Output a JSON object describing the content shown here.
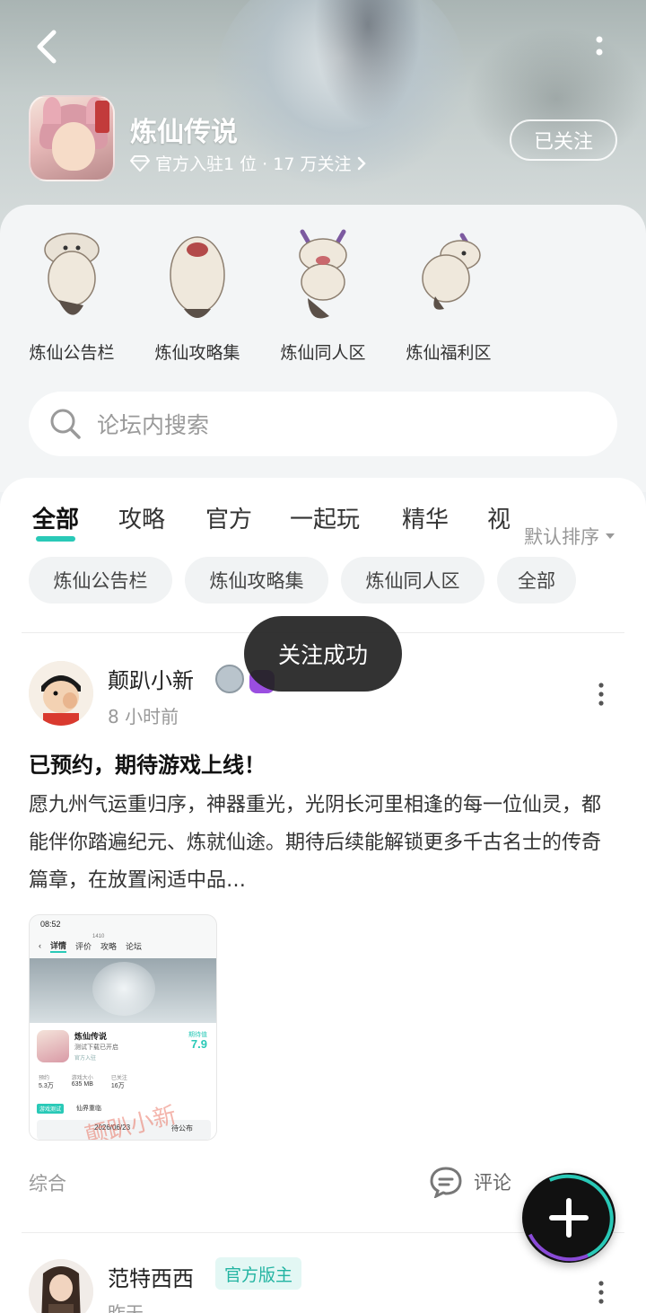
{
  "header": {
    "back_icon": "chevron-left-icon",
    "more_icon": "more-vertical-icon",
    "game_name": "炼仙传说",
    "meta": "官方入驻1 位 · 17 万关注",
    "follow_label": "已关注"
  },
  "sections": [
    {
      "label": "炼仙公告栏"
    },
    {
      "label": "炼仙攻略集"
    },
    {
      "label": "炼仙同人区"
    },
    {
      "label": "炼仙福利区"
    }
  ],
  "search": {
    "placeholder": "论坛内搜索"
  },
  "tabs": [
    "全部",
    "攻略",
    "官方",
    "一起玩",
    "精华",
    "视"
  ],
  "sort_label": "默认排序",
  "chips": [
    "炼仙公告栏",
    "炼仙攻略集",
    "炼仙同人区",
    "全部"
  ],
  "posts": [
    {
      "author": "颠趴小新",
      "time": "8 小时前",
      "title": "已预约，期待游戏上线！",
      "body": "愿九州气运重归序，神器重光，光阴长河里相逢的每一位仙灵，都能伴你踏遍纪元、炼就仙途。期待后续能解锁更多千古名士的传奇篇章，在放置闲适中品…",
      "tag": "综合",
      "comment_label": "评论",
      "screenshot": {
        "time": "08:52",
        "tabs": [
          "详情",
          "评价",
          "攻略",
          "论坛"
        ],
        "review_count": "1410",
        "game_name": "炼仙传说",
        "subtitle": "测试下载已开启",
        "badge": "官方入驻",
        "score_label": "期待值",
        "score": "7.9",
        "stats": [
          {
            "label": "预约",
            "value": "5.3万"
          },
          {
            "label": "游戏大小",
            "value": "635 MB"
          },
          {
            "label": "已关注",
            "value": "16万"
          }
        ],
        "test_tag": "游戏测试",
        "test_name": "仙界重临",
        "date": "2026/06/23",
        "date_right": "待公布",
        "watermark": "颠趴小新"
      }
    },
    {
      "author": "范特西西",
      "badge": "官方版主",
      "time": "昨天"
    }
  ],
  "toast": "关注成功",
  "colors": {
    "accent": "#29c9b7",
    "badge_bg": "#e3f7f4",
    "toast_bg": "#222222"
  }
}
